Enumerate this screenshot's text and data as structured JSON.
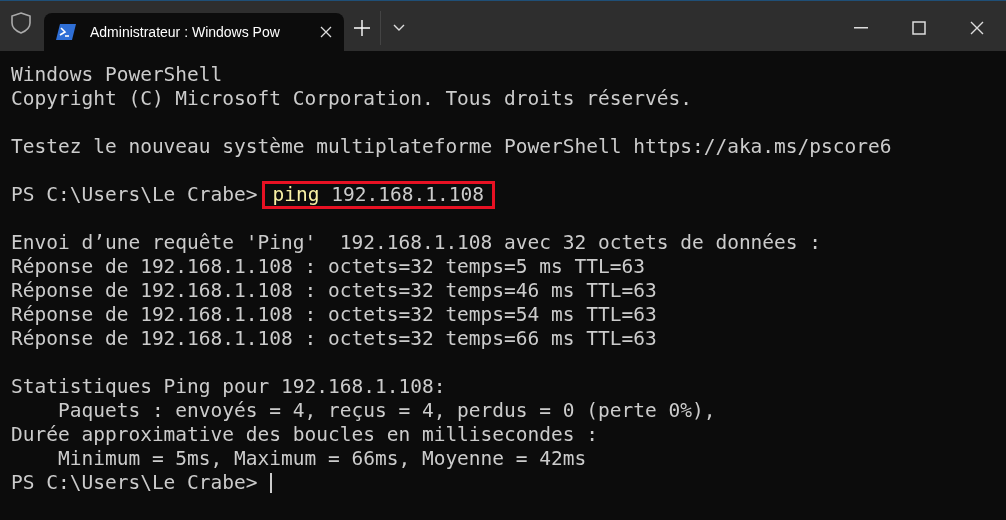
{
  "window": {
    "tab": {
      "title": "Administrateur : Windows Pow",
      "selected": true
    }
  },
  "terminal": {
    "lines": [
      {
        "kind": "output",
        "text": "Windows PowerShell"
      },
      {
        "kind": "output",
        "text": "Copyright (C) Microsoft Corporation. Tous droits réservés."
      },
      {
        "kind": "blank"
      },
      {
        "kind": "output",
        "text": "Testez le nouveau système multiplateforme PowerShell https://aka.ms/pscore6"
      },
      {
        "kind": "blank"
      },
      {
        "kind": "prompt",
        "prompt": "PS C:\\Users\\Le Crabe>",
        "command": "ping",
        "args": "192.168.1.108",
        "highlighted": true
      },
      {
        "kind": "blank"
      },
      {
        "kind": "output",
        "text": "Envoi d’une requête 'Ping'  192.168.1.108 avec 32 octets de données :"
      },
      {
        "kind": "output",
        "text": "Réponse de 192.168.1.108 : octets=32 temps=5 ms TTL=63"
      },
      {
        "kind": "output",
        "text": "Réponse de 192.168.1.108 : octets=32 temps=46 ms TTL=63"
      },
      {
        "kind": "output",
        "text": "Réponse de 192.168.1.108 : octets=32 temps=54 ms TTL=63"
      },
      {
        "kind": "output",
        "text": "Réponse de 192.168.1.108 : octets=32 temps=66 ms TTL=63"
      },
      {
        "kind": "blank"
      },
      {
        "kind": "output",
        "text": "Statistiques Ping pour 192.168.1.108:"
      },
      {
        "kind": "output",
        "text": "    Paquets : envoyés = 4, reçus = 4, perdus = 0 (perte 0%),"
      },
      {
        "kind": "output",
        "text": "Durée approximative des boucles en millisecondes :"
      },
      {
        "kind": "output",
        "text": "    Minimum = 5ms, Maximum = 66ms, Moyenne = 42ms"
      },
      {
        "kind": "prompt",
        "prompt": "PS C:\\Users\\Le Crabe>",
        "cursor": true
      }
    ]
  }
}
